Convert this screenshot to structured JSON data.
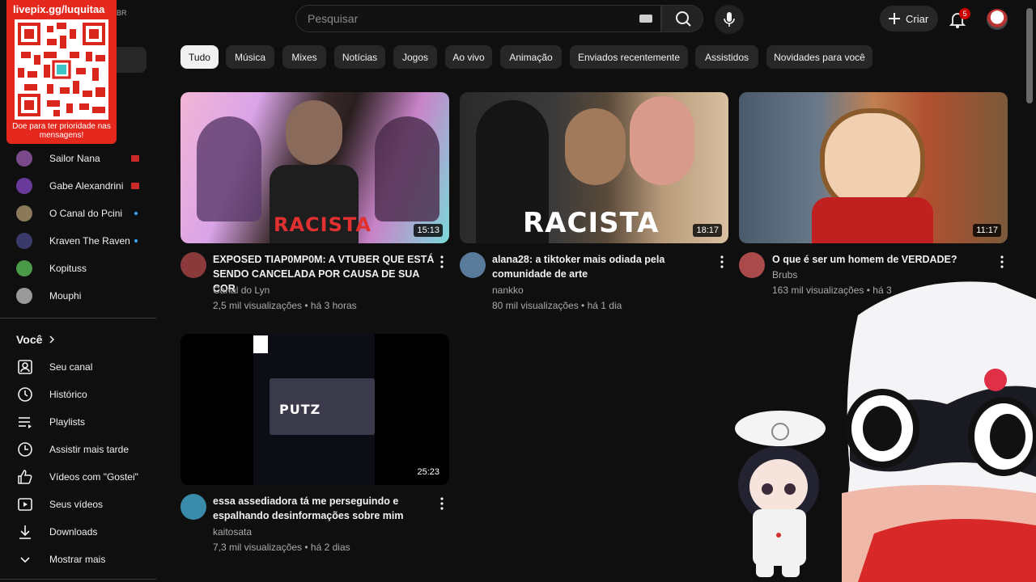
{
  "header": {
    "search_placeholder": "Pesquisar",
    "create_label": "Criar",
    "notifications_count": "5",
    "corner_partial": "BR"
  },
  "overlay": {
    "qr_url": "livepix.gg/luquitaa",
    "qr_caption": "Doe para ter prioridade nas mensagens!"
  },
  "sidebar": {
    "subscriptions": [
      {
        "name": "Sailor Nana",
        "badge": "live",
        "color": "#7a4a8a"
      },
      {
        "name": "Gabe Alexandrini",
        "badge": "live",
        "color": "#6a3a9a"
      },
      {
        "name": "O Canal do Pcini",
        "badge": "new",
        "color": "#8a7a5a"
      },
      {
        "name": "Kraven The Raven",
        "badge": "new",
        "color": "#3a3a6a"
      },
      {
        "name": "Kopituss",
        "badge": "",
        "color": "#4a9a4a"
      },
      {
        "name": "Mouphi",
        "badge": "",
        "color": "#9a9a9a"
      }
    ],
    "you_label": "Você",
    "you_items": [
      {
        "label": "Seu canal",
        "icon": "person-icon"
      },
      {
        "label": "Histórico",
        "icon": "history-icon"
      },
      {
        "label": "Playlists",
        "icon": "playlist-icon"
      },
      {
        "label": "Assistir mais tarde",
        "icon": "clock-icon"
      },
      {
        "label": "Vídeos com \"Gostei\"",
        "icon": "thumbs-up-icon"
      },
      {
        "label": "Seus vídeos",
        "icon": "video-icon"
      },
      {
        "label": "Downloads",
        "icon": "download-icon"
      },
      {
        "label": "Mostrar mais",
        "icon": "chevron-down-icon"
      }
    ]
  },
  "chips": [
    {
      "label": "Tudo",
      "active": true
    },
    {
      "label": "Música"
    },
    {
      "label": "Mixes"
    },
    {
      "label": "Notícias"
    },
    {
      "label": "Jogos"
    },
    {
      "label": "Ao vivo"
    },
    {
      "label": "Animação"
    },
    {
      "label": "Enviados recentemente"
    },
    {
      "label": "Assistidos"
    },
    {
      "label": "Novidades para você"
    }
  ],
  "videos": [
    {
      "title": "EXPOSED TIAP0MP0M: A VTUBER QUE ESTÁ SENDO CANCELADA POR CAUSA DE SUA COR",
      "channel": "Canal do Lyn",
      "views": "2,5 mil visualizações",
      "age": "há 3 horas",
      "duration": "15:13",
      "thumb_text": "RACISTA"
    },
    {
      "title": "alana28: a tiktoker mais odiada pela comunidade de arte",
      "channel": "nankko",
      "views": "80 mil visualizações",
      "age": "há 1 dia",
      "duration": "18:17",
      "thumb_text": "RACISTA"
    },
    {
      "title": "O que é ser um homem de VERDADE?",
      "channel": "Brubs",
      "views": "163 mil visualizações",
      "age": "há 3",
      "duration": "11:17",
      "thumb_text": ""
    },
    {
      "title": "essa assediadora tá me perseguindo e espalhando desinformações sobre mim",
      "channel": "kaitosata",
      "views": "7,3 mil visualizações",
      "age": "há 2 dias",
      "duration": "25:23",
      "thumb_text": "PUTZ"
    }
  ],
  "colors": {
    "accent_red": "#e4281e",
    "background": "#0f0f0f",
    "chip_bg": "#272727"
  }
}
